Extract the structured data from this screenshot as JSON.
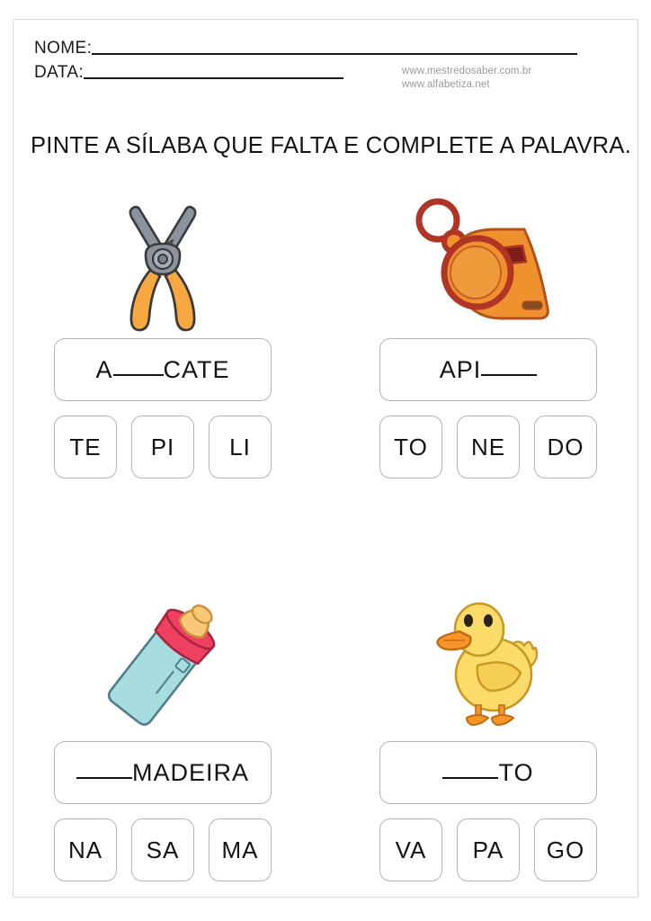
{
  "header": {
    "name_label": "NOME:",
    "date_label": "DATA:",
    "site1": "www.mestredosaber.com.br",
    "site2": "www.alfabetiza.net"
  },
  "title": "PINTE A SÍLABA QUE FALTA E COMPLETE A PALAVRA.",
  "exercises": [
    {
      "picture": "pliers-illustration",
      "picture_label": "ALICATE",
      "word_prefix": "A",
      "blank_position": "middle",
      "word_suffix": "CATE",
      "word_display": "A___CATE",
      "options": [
        "TE",
        "PI",
        "LI"
      ],
      "answer": "LI"
    },
    {
      "picture": "whistle-illustration",
      "picture_label": "APITO",
      "word_prefix": "API",
      "blank_position": "end",
      "word_suffix": "",
      "word_display": "API___",
      "options": [
        "TO",
        "NE",
        "DO"
      ],
      "answer": "TO"
    },
    {
      "picture": "baby-bottle-illustration",
      "picture_label": "MAMADEIRA",
      "word_prefix": "",
      "blank_position": "start",
      "word_suffix": "MADEIRA",
      "word_display": "___MADEIRA",
      "options": [
        "NA",
        "SA",
        "MA"
      ],
      "answer": "MA"
    },
    {
      "picture": "duck-illustration",
      "picture_label": "PATO",
      "word_prefix": "",
      "blank_position": "start",
      "word_suffix": "TO",
      "word_display": "___TO",
      "options": [
        "VA",
        "PA",
        "GO"
      ],
      "answer": "PA"
    }
  ],
  "colors": {
    "ink": "#141414",
    "box_border": "#b5b5b5",
    "page_border": "#d9d9d9",
    "watermark": "#9a9a9a",
    "pliers_handle": "#f7a840",
    "pliers_metal": "#8b93a0",
    "whistle_body": "#f0912f",
    "whistle_ring": "#b03524",
    "bottle_body": "#a8dde0",
    "bottle_collar": "#ef4060",
    "bottle_nipple": "#f8c777",
    "duck_body": "#fbdc6a",
    "duck_beak": "#f79528"
  }
}
